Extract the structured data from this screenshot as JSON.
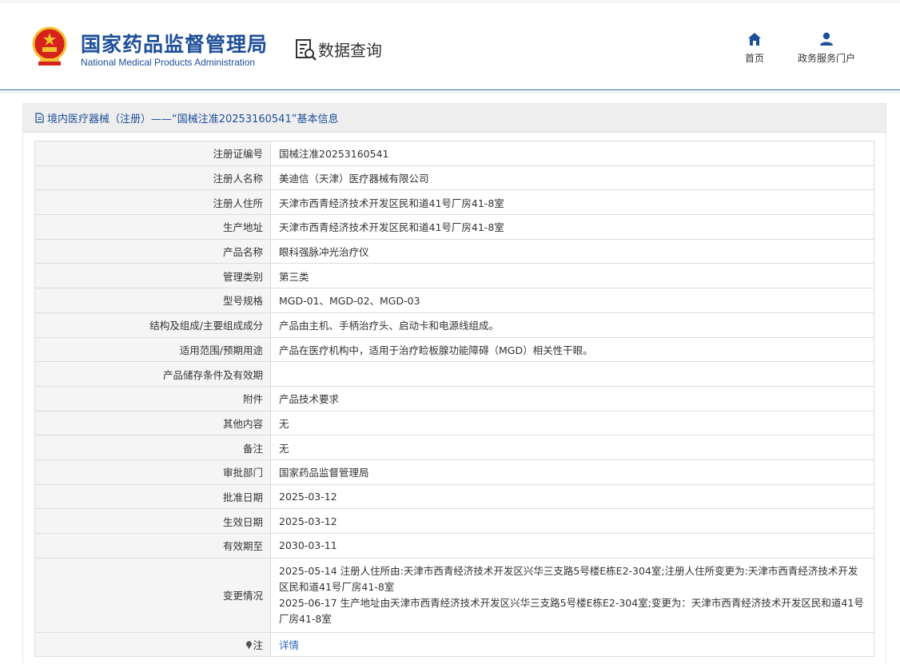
{
  "header": {
    "brand_cn": "国家药品监督管理局",
    "brand_en": "National Medical Products Administration",
    "section_title": "数据查询",
    "nav": [
      {
        "label": "首页",
        "icon": "home-icon"
      },
      {
        "label": "政务服务门户",
        "icon": "user-icon"
      }
    ],
    "colors": {
      "brand": "#1d4f9a",
      "emblem_red": "#d5221c",
      "emblem_gold": "#f2c12e"
    }
  },
  "panel": {
    "title": "境内医疗器械（注册）——“国械注准20253160541”基本信息"
  },
  "rows": [
    {
      "label": "注册证编号",
      "value": "国械注准20253160541"
    },
    {
      "label": "注册人名称",
      "value": "美迪信（天津）医疗器械有限公司"
    },
    {
      "label": "注册人住所",
      "value": "天津市西青经济技术开发区民和道41号厂房41-8室"
    },
    {
      "label": "生产地址",
      "value": "天津市西青经济技术开发区民和道41号厂房41-8室"
    },
    {
      "label": "产品名称",
      "value": "眼科强脉冲光治疗仪"
    },
    {
      "label": "管理类别",
      "value": "第三类"
    },
    {
      "label": "型号规格",
      "value": "MGD-01、MGD-02、MGD-03"
    },
    {
      "label": "结构及组成/主要组成成分",
      "value": "产品由主机、手柄治疗头、启动卡和电源线组成。"
    },
    {
      "label": "适用范围/预期用途",
      "value": "产品在医疗机构中，适用于治疗睑板腺功能障碍（MGD）相关性干眼。"
    },
    {
      "label": "产品储存条件及有效期",
      "value": ""
    },
    {
      "label": "附件",
      "value": "产品技术要求"
    },
    {
      "label": "其他内容",
      "value": "无"
    },
    {
      "label": "备注",
      "value": "无"
    },
    {
      "label": "审批部门",
      "value": "国家药品监督管理局"
    },
    {
      "label": "批准日期",
      "value": "2025-03-12"
    },
    {
      "label": "生效日期",
      "value": "2025-03-12"
    },
    {
      "label": "有效期至",
      "value": "2030-03-11"
    }
  ],
  "change": {
    "label": "变更情况",
    "line1": "2025-05-14 注册人住所由:天津市西青经济技术开发区兴华三支路5号楼E栋E2-304室;注册人住所变更为:天津市西青经济技术开发区民和道41号厂房41-8室",
    "line2": "2025-06-17 生产地址由天津市西青经济技术开发区兴华三支路5号楼E栋E2-304室;变更为：天津市西青经济技术开发区民和道41号厂房41-8室"
  },
  "note": {
    "label": "注",
    "icon": "pin-icon",
    "link": "详情"
  }
}
